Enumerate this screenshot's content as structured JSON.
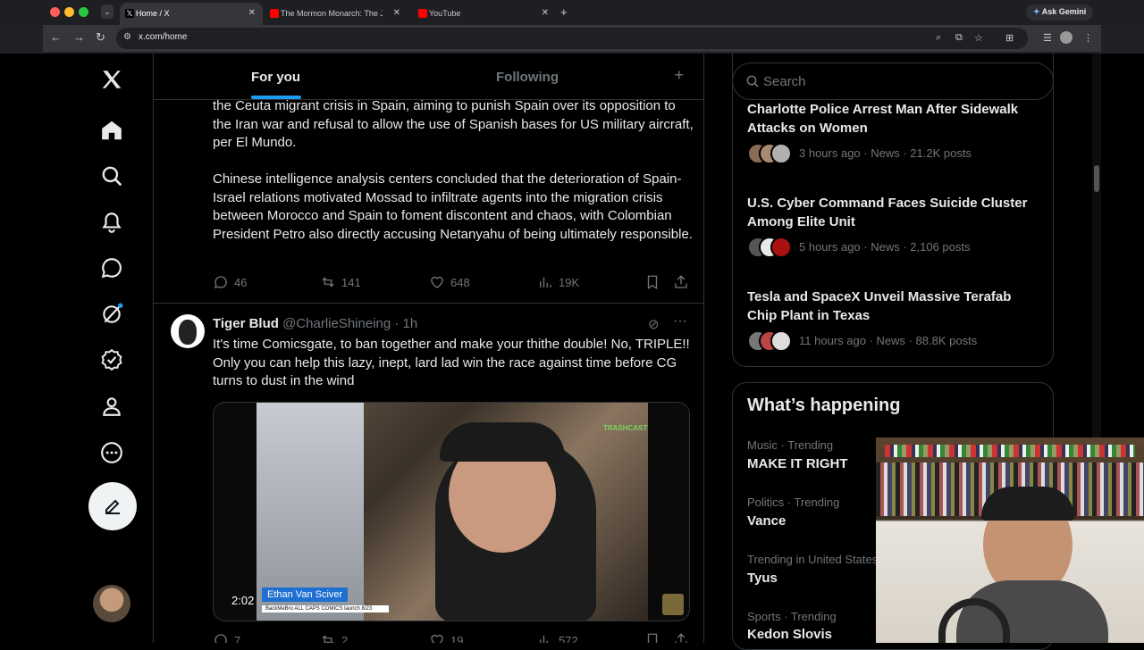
{
  "browser": {
    "tabs": [
      {
        "title": "Home / X",
        "active": true
      },
      {
        "title": "The Mormon Monarch: The Ji",
        "active": false
      },
      {
        "title": "YouTube",
        "active": false
      }
    ],
    "new_tab": "+",
    "url": "x.com/home",
    "gemini_label": "Ask Gemini"
  },
  "timeline": {
    "tab_for_you": "For you",
    "tab_following": "Following",
    "post1": {
      "paragraph1": "the Ceuta migrant crisis in Spain, aiming to punish Spain over its opposition to the Iran war and refusal to allow the use of Spanish bases for US military aircraft, per El Mundo.",
      "paragraph2": "Chinese intelligence analysis centers concluded that the deterioration of Spain-Israel relations motivated Mossad to infiltrate agents into the migration crisis between Morocco and Spain to foment discontent and chaos, with Colombian President Petro also directly accusing Netanyahu of being ultimately responsible.",
      "replies": "46",
      "reposts": "141",
      "likes": "648",
      "views": "19K"
    },
    "post2": {
      "author": "Tiger Blud",
      "handle": "@CharlieShineing",
      "time": "· 1h",
      "text": "It's time Comicsgate,  to ban together and make your thithe double! No, TRIPLE!! Only you can help this lazy, inept, lard lad win the race against time before CG turns to dust in the wind",
      "video_duration": "2:02",
      "video_name_tag": "Ethan Van Sciver",
      "video_caption": "BackMeBro ALL CAPS COMICS launch 8/23",
      "video_logo": "TRASHCAST",
      "replies": "7",
      "reposts": "2",
      "likes": "19",
      "views": "572"
    }
  },
  "sidebar": {
    "search_placeholder": "Search",
    "news": [
      {
        "title": "Charlotte Police Arrest Man After Sidewalk Attacks on Women",
        "meta": "3 hours ago · News · 21.2K posts"
      },
      {
        "title": "U.S. Cyber Command Faces Suicide Cluster Among Elite Unit",
        "meta": "5 hours ago · News · 2,106 posts"
      },
      {
        "title": "Tesla and SpaceX Unveil Massive Terafab Chip Plant in Texas",
        "meta": "11 hours ago · News · 88.8K posts"
      }
    ],
    "happening_title": "What’s happening",
    "trends": [
      {
        "category": "Music · Trending",
        "name": "MAKE IT RIGHT"
      },
      {
        "category": "Politics · Trending",
        "name": "Vance"
      },
      {
        "category": "Trending in United States",
        "name": "Tyus"
      },
      {
        "category": "Sports · Trending",
        "name": "Kedon Slovis"
      }
    ]
  },
  "colors": {
    "accent": "#1d9bf0",
    "background": "#000000",
    "text": "#e7e9ea",
    "muted": "#71767b",
    "border": "#2f3336"
  }
}
